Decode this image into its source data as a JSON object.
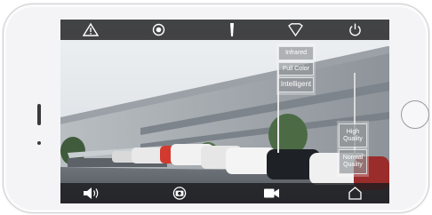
{
  "colors": {
    "bar_background": "#1c1c1e",
    "icon_color": "#ffffff",
    "phone_body": "#f4f4f6"
  },
  "top_toolbar": {
    "icons": [
      "warning-triangle-icon",
      "record-dot-icon",
      "flashlight-icon",
      "diamond-icon",
      "power-icon"
    ]
  },
  "bottom_toolbar": {
    "icons": [
      "speaker-icon",
      "camera-snapshot-icon",
      "video-record-icon",
      "home-outline-icon"
    ]
  },
  "color_mode_menu": {
    "items": [
      "Infrared",
      "Full Color",
      "Intelligent"
    ]
  },
  "quality_menu": {
    "items": [
      "High Quality",
      "Normal Quality"
    ]
  }
}
